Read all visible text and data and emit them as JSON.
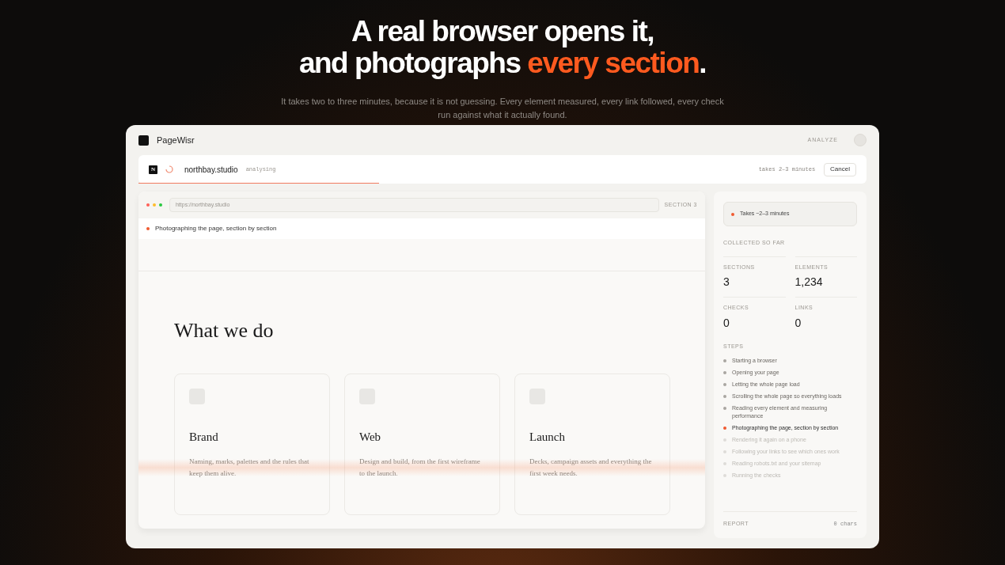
{
  "hero": {
    "title_line_1": "A real browser opens it,",
    "title_line_2_plain": "and photographs",
    "title_line_2_accent": "every section",
    "title_line_2_end": ".",
    "subtitle": "It takes two to three minutes, because it is not guessing. Every element measured, every link followed, every check run against what it actually found."
  },
  "app": {
    "brand": "PageWisr",
    "nav_label": "ANALYZE"
  },
  "analysis": {
    "site_initial": "N",
    "site": "northbay.studio",
    "status": "analysing",
    "eta": "takes 2–3 minutes",
    "cancel": "Cancel",
    "level": 0.33
  },
  "browser": {
    "url": "https://northbay.studio",
    "section_label": "SECTION 3",
    "banner": "Photographing the page, section by section",
    "heading": "What we do",
    "cards": [
      {
        "title": "Brand",
        "text": "Naming, marks, palettes and the rules that keep them alive."
      },
      {
        "title": "Web",
        "text": "Design and build, from the first wireframe to the launch."
      },
      {
        "title": "Launch",
        "text": "Decks, campaign assets and everything the first week needs."
      }
    ]
  },
  "sidebar": {
    "notice": "Takes ~2–3 minutes",
    "collected_label": "COLLECTED SO FAR",
    "stats": [
      {
        "label": "SECTIONS",
        "value": "3"
      },
      {
        "label": "ELEMENTS",
        "value": "1,234"
      },
      {
        "label": "CHECKS",
        "value": "0"
      },
      {
        "label": "LINKS",
        "value": "0"
      }
    ],
    "steps_label": "STEPS",
    "steps": [
      {
        "text": "Starting a browser",
        "done": true,
        "current": false
      },
      {
        "text": "Opening your page",
        "done": true,
        "current": false
      },
      {
        "text": "Letting the whole page load",
        "done": true,
        "current": false
      },
      {
        "text": "Scrolling the whole page so everything loads",
        "done": true,
        "current": false
      },
      {
        "text": "Reading every element and measuring performance",
        "done": true,
        "current": false
      },
      {
        "text": "Photographing the page, section by section",
        "done": false,
        "current": true
      },
      {
        "text": "Rendering it again on a phone",
        "done": false,
        "current": false
      },
      {
        "text": "Following your links to see which ones work",
        "done": false,
        "current": false
      },
      {
        "text": "Reading robots.txt and your sitemap",
        "done": false,
        "current": false
      },
      {
        "text": "Running the checks",
        "done": false,
        "current": false
      }
    ],
    "report_label": "REPORT",
    "report_count": "0 chars"
  }
}
